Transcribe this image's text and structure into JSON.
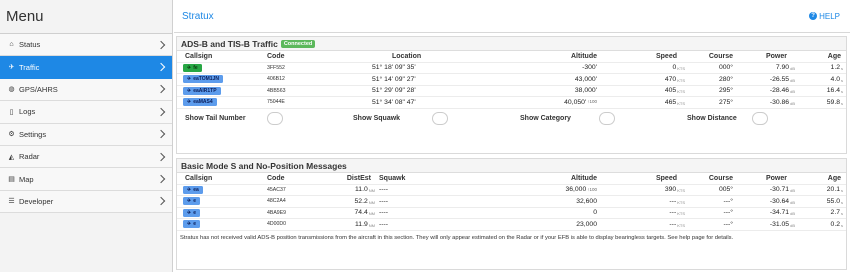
{
  "sidebar": {
    "title": "Menu",
    "items": [
      {
        "label": "Status",
        "icon": "home-icon",
        "glyph": "⌂",
        "active": false
      },
      {
        "label": "Traffic",
        "icon": "plane-icon",
        "glyph": "✈",
        "active": true
      },
      {
        "label": "GPS/AHRS",
        "icon": "globe-icon",
        "glyph": "◍",
        "active": false
      },
      {
        "label": "Logs",
        "icon": "file-icon",
        "glyph": "▯",
        "active": false
      },
      {
        "label": "Settings",
        "icon": "gear-icon",
        "glyph": "⚙",
        "active": false
      },
      {
        "label": "Radar",
        "icon": "radar-icon",
        "glyph": "◭",
        "active": false
      },
      {
        "label": "Map",
        "icon": "map-icon",
        "glyph": "▤",
        "active": false
      },
      {
        "label": "Developer",
        "icon": "list-icon",
        "glyph": "☰",
        "active": false
      }
    ]
  },
  "topbar": {
    "title": "Stratux",
    "help_label": "HELP",
    "help_glyph": "?"
  },
  "adsb": {
    "title": "ADS-B and TIS-B Traffic",
    "badge": "Connected",
    "columns": {
      "callsign": "Callsign",
      "code": "Code",
      "location": "Location",
      "altitude": "Altitude",
      "speed": "Speed",
      "course": "Course",
      "power": "Power",
      "age": "Age"
    },
    "rows": [
      {
        "callsign": "fe",
        "style": "green",
        "code": "3FF552",
        "location": "51° 18' 09\" 35'",
        "altitude": "-300'",
        "alt_extra": "",
        "speed": "0",
        "speed_unit": "KTS",
        "course": "000°",
        "power": "7.90",
        "power_unit": "dB",
        "age": "1.2",
        "age_unit": "s"
      },
      {
        "callsign": "eaTOM1JN",
        "style": "blue",
        "code": "406B12",
        "location": "51° 14' 09\" 27'",
        "altitude": "43,000'",
        "alt_extra": "",
        "speed": "470",
        "speed_unit": "KTS",
        "course": "280°",
        "power": "-26.55",
        "power_unit": "dB",
        "age": "4.0",
        "age_unit": "s"
      },
      {
        "callsign": "eaAIR1TP",
        "style": "blue",
        "code": "4BB563",
        "location": "51° 29' 09\" 28'",
        "altitude": "38,000'",
        "alt_extra": "",
        "speed": "405",
        "speed_unit": "KTS",
        "course": "295°",
        "power": "-28.46",
        "power_unit": "dB",
        "age": "16.4",
        "age_unit": "s"
      },
      {
        "callsign": "eaMAS4",
        "style": "blue",
        "code": "75044E",
        "location": "51° 34' 08\" 47'",
        "altitude": "40,050'",
        "alt_extra": "↑100",
        "speed": "465",
        "speed_unit": "KTS",
        "course": "275°",
        "power": "-30.86",
        "power_unit": "dB",
        "age": "59.8",
        "age_unit": "s"
      }
    ],
    "toggles": {
      "tail": "Show Tail Number",
      "squawk": "Show Squawk",
      "category": "Show Category",
      "distance": "Show Distance"
    }
  },
  "modes": {
    "title": "Basic Mode S and No-Position Messages",
    "columns": {
      "callsign": "Callsign",
      "code": "Code",
      "dist": "DistEst",
      "squawk": "Squawk",
      "altitude": "Altitude",
      "speed": "Speed",
      "course": "Course",
      "power": "Power",
      "age": "Age"
    },
    "rows": [
      {
        "callsign": "ea",
        "code": "45AC37",
        "dist": "11.0",
        "dist_unit": "NM",
        "squawk": "----",
        "altitude": "36,000",
        "alt_extra": "↑100",
        "speed": "390",
        "speed_unit": "KTS",
        "course": "005°",
        "power": "-30.71",
        "power_unit": "dB",
        "age": "20.1",
        "age_unit": "s"
      },
      {
        "callsign": "e",
        "code": "48C2A4",
        "dist": "52.2",
        "dist_unit": "NM",
        "squawk": "----",
        "altitude": "32,600",
        "alt_extra": "",
        "speed": "---",
        "speed_unit": "KTS",
        "course": "---°",
        "power": "-30.64",
        "power_unit": "dB",
        "age": "55.0",
        "age_unit": "s"
      },
      {
        "callsign": "e",
        "code": "4BA9E9",
        "dist": "74.4",
        "dist_unit": "NM",
        "squawk": "----",
        "altitude": "0",
        "alt_extra": "",
        "speed": "---",
        "speed_unit": "KTS",
        "course": "---°",
        "power": "-34.71",
        "power_unit": "dB",
        "age": "2.7",
        "age_unit": "s"
      },
      {
        "callsign": "e",
        "code": "4D00D0",
        "dist": "11.9",
        "dist_unit": "NM",
        "squawk": "----",
        "altitude": "23,000",
        "alt_extra": "",
        "speed": "---",
        "speed_unit": "KTS",
        "course": "---°",
        "power": "-31.05",
        "power_unit": "dB",
        "age": "0.2",
        "age_unit": "s"
      }
    ],
    "note": "Stratux has not received valid ADS-B position transmissions from the aircraft in this section. They will only appear estimated on the Radar or if your EFB is able to display bearingless targets. See help page for details."
  },
  "colors": {
    "accent": "#1e88e5",
    "connected": "#5cb85c",
    "callsign_blue": "#5d9cec",
    "callsign_green": "#28a745"
  }
}
